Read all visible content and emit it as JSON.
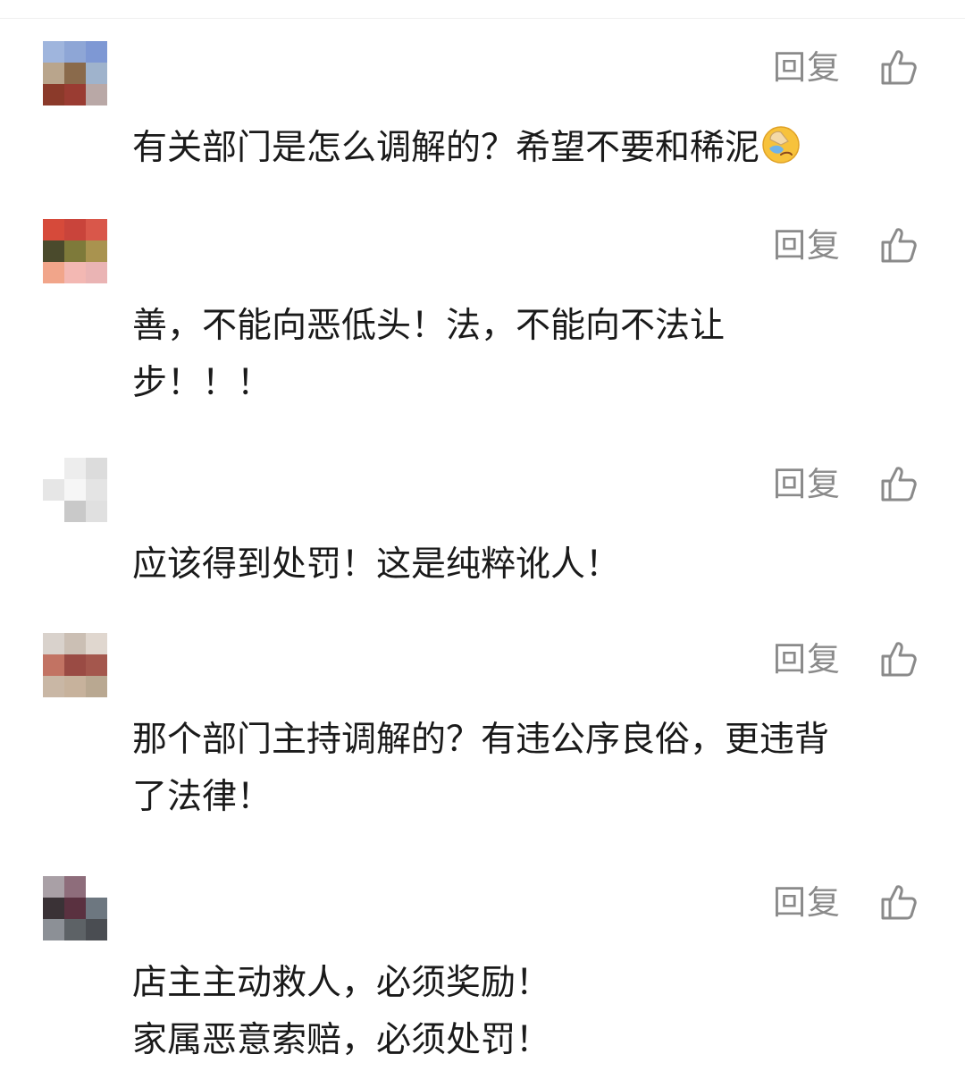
{
  "comments": [
    {
      "username": "",
      "reply_label": "回复",
      "text_lines": [
        "有关部门是怎么调解的？希望不要和稀泥"
      ],
      "trailing_emoji": "face-palm-crying-emoji"
    },
    {
      "username": "",
      "reply_label": "回复",
      "text_lines": [
        "善，不能向恶低头！法，不能向不法让",
        "步！！！"
      ]
    },
    {
      "username": "",
      "reply_label": "回复",
      "text_lines": [
        "应该得到处罚！这是纯粹讹人！"
      ]
    },
    {
      "username": "",
      "reply_label": "回复",
      "text_lines": [
        "那个部门主持调解的？有违公序良俗，更违背",
        "了法律！"
      ]
    },
    {
      "username": "",
      "reply_label": "回复",
      "text_lines": [
        "店主主动救人，必须奖励！",
        "家属恶意索赔，必须处罚！"
      ]
    }
  ],
  "icons": {
    "like": "thumbs-up-icon",
    "emoji": "face-palm-crying-emoji"
  },
  "colors": {
    "reply_text": "#8a8a8a",
    "comment_text": "#1a1a1a",
    "icon_stroke": "#8a8a8a"
  }
}
